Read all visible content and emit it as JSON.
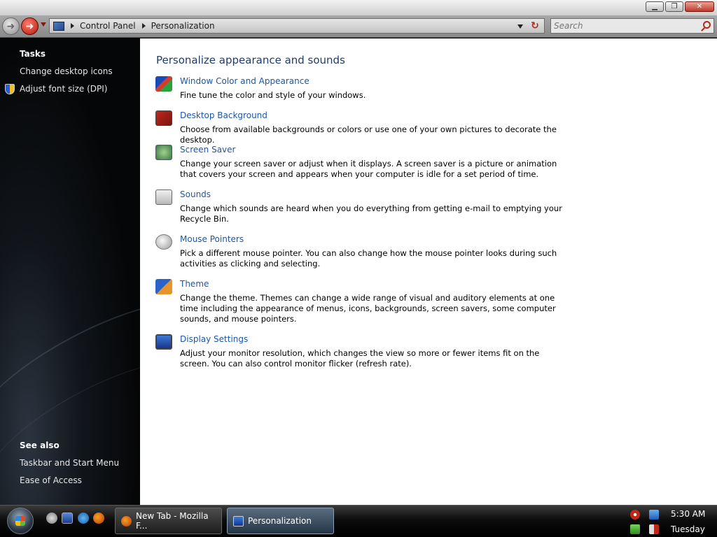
{
  "window": {
    "controls": {
      "minimize": "▁",
      "maximize": "❐",
      "close": "✕"
    }
  },
  "addressbar": {
    "breadcrumbs": [
      "Control Panel",
      "Personalization"
    ],
    "search_placeholder": "Search"
  },
  "sidebar": {
    "tasks_heading": "Tasks",
    "tasks": [
      "Change desktop icons",
      "Adjust font size (DPI)"
    ],
    "see_also_heading": "See also",
    "see_also": [
      "Taskbar and Start Menu",
      "Ease of Access"
    ]
  },
  "main": {
    "title": "Personalize appearance and sounds",
    "items": [
      {
        "icon": "color-palette-icon",
        "title": "Window Color and Appearance",
        "desc": "Fine tune the color and style of your windows."
      },
      {
        "icon": "desktop-background-icon",
        "title": "Desktop Background",
        "desc": "Choose from available backgrounds or colors or use one of your own pictures to decorate the desktop."
      },
      {
        "icon": "screen-saver-icon",
        "title": "Screen Saver",
        "desc": "Change your screen saver or adjust when it displays. A screen saver is a picture or animation that covers your screen and appears when your computer is idle for a set period of time."
      },
      {
        "icon": "sounds-icon",
        "title": "Sounds",
        "desc": "Change which sounds are heard when you do everything from getting e-mail to emptying your Recycle Bin."
      },
      {
        "icon": "mouse-icon",
        "title": "Mouse Pointers",
        "desc": "Pick a different mouse pointer. You can also change how the mouse pointer looks during such activities as clicking and selecting."
      },
      {
        "icon": "theme-icon",
        "title": "Theme",
        "desc": "Change the theme. Themes can change a wide range of visual and auditory elements at one time including the appearance of menus, icons, backgrounds, screen savers, some computer sounds, and mouse pointers."
      },
      {
        "icon": "display-icon",
        "title": "Display Settings",
        "desc": "Adjust your monitor resolution, which changes the view so more or fewer items fit on the screen. You can also control monitor flicker (refresh rate)."
      }
    ]
  },
  "taskbar": {
    "buttons": [
      "New Tab - Mozilla F...",
      "Personalization"
    ],
    "active_button": "Personalization",
    "clock_time": "5:30 AM",
    "clock_day": "Tuesday"
  }
}
